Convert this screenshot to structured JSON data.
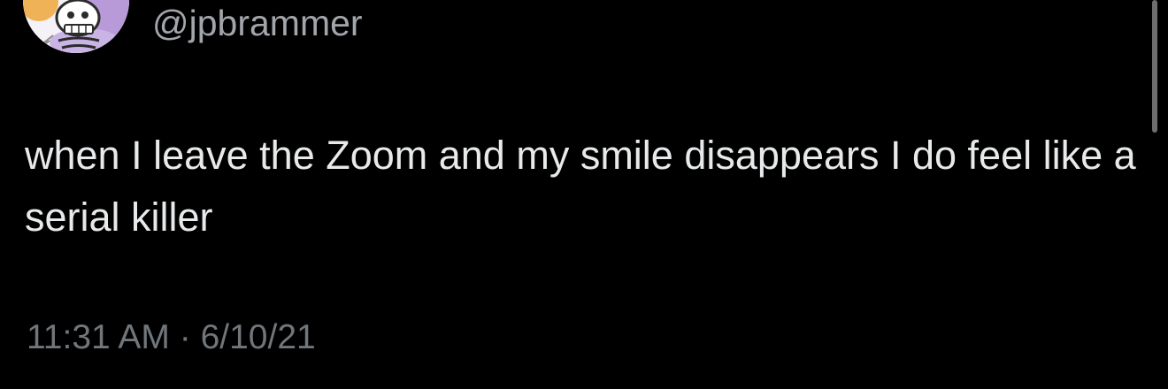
{
  "tweet": {
    "handle": "@jpbrammer",
    "text": "when I leave the Zoom and my smile disappears I do feel like a serial killer",
    "time": "11:31 AM",
    "separator": "·",
    "date": "6/10/21",
    "avatar_icon": "skeleton-avatar-icon"
  },
  "colors": {
    "background": "#000000",
    "text": "#e7e9ea",
    "secondary": "#71767b",
    "avatar_accent": "#b99ad8"
  }
}
